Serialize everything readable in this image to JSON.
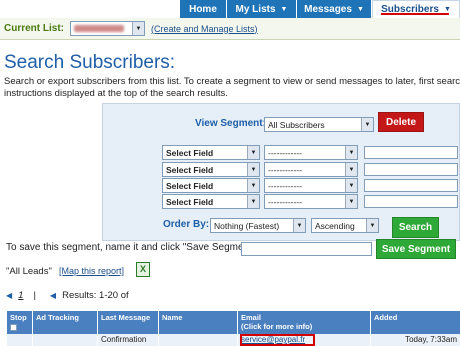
{
  "nav": {
    "tabs": [
      {
        "label": "Home"
      },
      {
        "label": "My Lists"
      },
      {
        "label": "Messages"
      },
      {
        "label": "Subscribers"
      }
    ]
  },
  "current_list": {
    "label": "Current List:",
    "manage_link": "(Create and Manage Lists)"
  },
  "page": {
    "title": "Search Subscribers:",
    "description_line1": "Search or export subscribers from this list. To create a segment to view or send messages to later, first search y",
    "description_line2": "instructions displayed at the top of the search results."
  },
  "segment": {
    "view_label": "View Segment:",
    "selected": "All Subscribers",
    "delete_label": "Delete"
  },
  "filters": [
    {
      "field": "Select Field",
      "operator": "------------",
      "value": ""
    },
    {
      "field": "Select Field",
      "operator": "------------",
      "value": ""
    },
    {
      "field": "Select Field",
      "operator": "------------",
      "value": ""
    },
    {
      "field": "Select Field",
      "operator": "------------",
      "value": ""
    }
  ],
  "order": {
    "label": "Order By:",
    "field": "Nothing (Fastest)",
    "direction": "Ascending",
    "search_label": "Search"
  },
  "save": {
    "prompt": "To save this segment, name it and click \"Save Segment\":",
    "button_label": "Save Segment",
    "value": ""
  },
  "results": {
    "segment_name": "\"All Leads\"",
    "map_link": "[Map this report]",
    "page": "1",
    "pager_sep": "|",
    "summary": "Results: 1-20 of"
  },
  "table": {
    "headers": {
      "stop": "Stop",
      "ad_tracking": "Ad Tracking",
      "last_message": "Last Message",
      "name": "Name",
      "email": "Email",
      "email_hint": "(Click for more info)",
      "added": "Added"
    },
    "rows": [
      {
        "ad_tracking": "",
        "last_message": "Confirmation",
        "name": "",
        "email": "service@paypal.fr",
        "added": "Today, 7:33am"
      }
    ]
  },
  "colors": {
    "nav_blue": "#1f73b7",
    "active_underline": "#d40000",
    "delete_red": "#c41818",
    "action_green": "#2ea836",
    "panel_bg": "#e6eef7",
    "header_blue": "#4a7fc0"
  }
}
